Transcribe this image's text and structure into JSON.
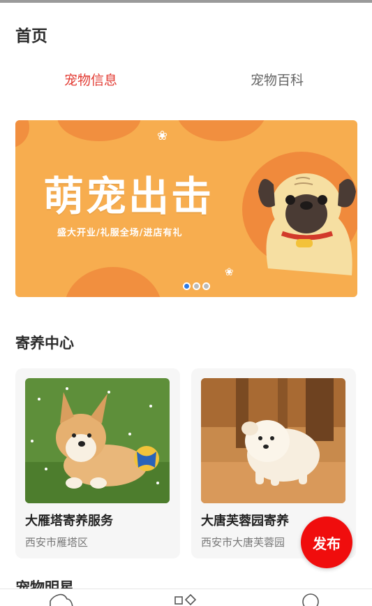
{
  "header": {
    "title": "首页"
  },
  "tabs": [
    {
      "label": "宠物信息",
      "active": true
    },
    {
      "label": "宠物百科",
      "active": false
    }
  ],
  "banner": {
    "headline": "萌宠出击",
    "subtitle": "盛大开业/礼服全场/进店有礼",
    "slides": 3,
    "active_slide": 1
  },
  "boarding": {
    "title": "寄养中心",
    "items": [
      {
        "name": "大雁塔寄养服务",
        "address": "西安市雁塔区"
      },
      {
        "name": "大唐芙蓉园寄养",
        "address": "西安市大唐芙蓉园"
      }
    ]
  },
  "next_section": {
    "title": "宠物明星"
  },
  "publish": {
    "label": "发布"
  },
  "bottom_nav": [
    {
      "icon": "home-icon"
    },
    {
      "icon": "category-icon"
    },
    {
      "icon": "profile-icon"
    }
  ],
  "colors": {
    "accent": "#e23a32",
    "publish": "#f00d0d",
    "banner_bg": "#f7ad4f",
    "dot_active": "#2d7be5"
  }
}
